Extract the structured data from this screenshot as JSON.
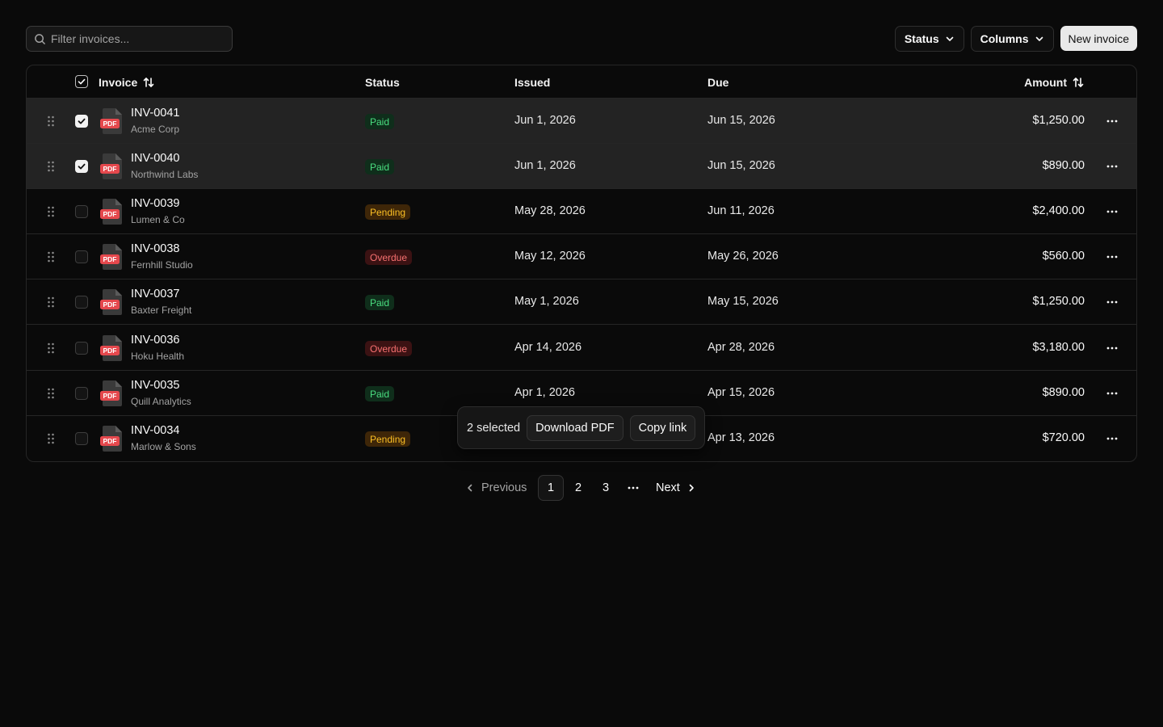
{
  "toolbar": {
    "search_placeholder": "Filter invoices...",
    "status_label": "Status",
    "columns_label": "Columns",
    "new_invoice_label": "New invoice"
  },
  "table": {
    "headers": {
      "invoice": "Invoice",
      "status": "Status",
      "issued": "Issued",
      "due": "Due",
      "amount": "Amount"
    },
    "header_checkbox_checked": true,
    "file_icon_text": "PDF",
    "rows": [
      {
        "id": "INV-0041",
        "client": "Acme Corp",
        "status": "Paid",
        "issued": "Jun 1, 2026",
        "due": "Jun 15, 2026",
        "amount": "$1,250.00",
        "selected": true
      },
      {
        "id": "INV-0040",
        "client": "Northwind Labs",
        "status": "Paid",
        "issued": "Jun 1, 2026",
        "due": "Jun 15, 2026",
        "amount": "$890.00",
        "selected": true
      },
      {
        "id": "INV-0039",
        "client": "Lumen & Co",
        "status": "Pending",
        "issued": "May 28, 2026",
        "due": "Jun 11, 2026",
        "amount": "$2,400.00",
        "selected": false
      },
      {
        "id": "INV-0038",
        "client": "Fernhill Studio",
        "status": "Overdue",
        "issued": "May 12, 2026",
        "due": "May 26, 2026",
        "amount": "$560.00",
        "selected": false
      },
      {
        "id": "INV-0037",
        "client": "Baxter Freight",
        "status": "Paid",
        "issued": "May 1, 2026",
        "due": "May 15, 2026",
        "amount": "$1,250.00",
        "selected": false
      },
      {
        "id": "INV-0036",
        "client": "Hoku Health",
        "status": "Overdue",
        "issued": "Apr 14, 2026",
        "due": "Apr 28, 2026",
        "amount": "$3,180.00",
        "selected": false
      },
      {
        "id": "INV-0035",
        "client": "Quill Analytics",
        "status": "Paid",
        "issued": "Apr 1, 2026",
        "due": "Apr 15, 2026",
        "amount": "$890.00",
        "selected": false
      },
      {
        "id": "INV-0034",
        "client": "Marlow & Sons",
        "status": "Pending",
        "issued": "",
        "due": "Apr 13, 2026",
        "amount": "$720.00",
        "selected": false
      }
    ]
  },
  "bulk_actions": {
    "selected_text": "2 selected",
    "download_label": "Download PDF",
    "copy_label": "Copy link"
  },
  "pagination": {
    "previous_label": "Previous",
    "pages": [
      "1",
      "2",
      "3"
    ],
    "active_page": "1",
    "next_label": "Next"
  },
  "colors": {
    "background": "#0a0a0a",
    "paid": "#4ade80",
    "pending": "#fbbf24",
    "overdue": "#f87171",
    "pdf_red": "#e5484d"
  }
}
